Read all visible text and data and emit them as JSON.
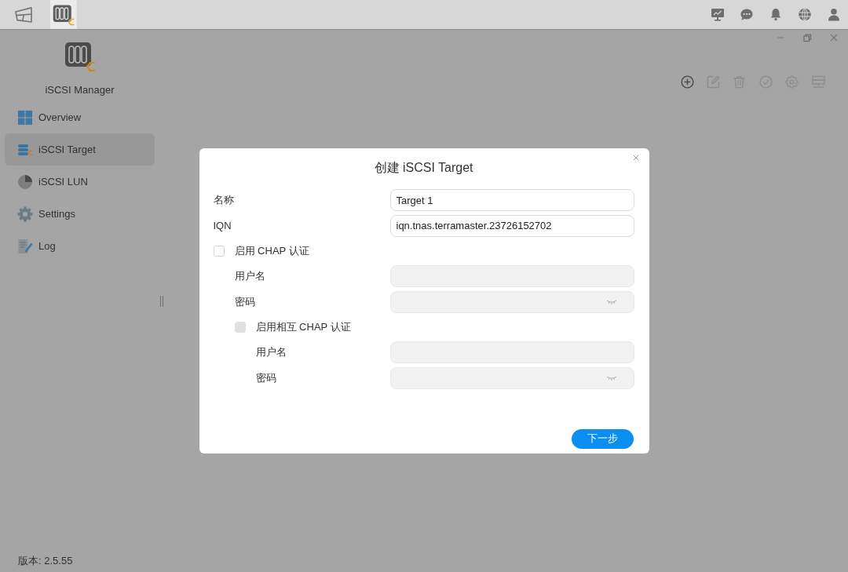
{
  "taskbar": {
    "items": [
      {
        "kind": "desktop",
        "selected": false
      },
      {
        "kind": "app",
        "selected": true
      }
    ]
  },
  "window": {
    "app_name": "iSCSI Manager",
    "nav": [
      {
        "label": "Overview",
        "selected": false
      },
      {
        "label": "iSCSI Target",
        "selected": true
      },
      {
        "label": "iSCSI LUN",
        "selected": false
      },
      {
        "label": "Settings",
        "selected": false
      },
      {
        "label": "Log",
        "selected": false
      }
    ],
    "version": "版本: 2.5.55",
    "toolbar": [
      {
        "disabled": false
      },
      {
        "disabled": true
      },
      {
        "disabled": true
      },
      {
        "disabled": true
      },
      {
        "disabled": true
      },
      {
        "disabled": true
      }
    ]
  },
  "dialog": {
    "title": "创建 iSCSI Target",
    "fields": [
      {
        "kind": "input",
        "label": "名称",
        "value": "Target 1",
        "disabled": false
      },
      {
        "kind": "input",
        "label": "IQN",
        "value": "iqn.tnas.terramaster.23726152702",
        "disabled": false
      },
      {
        "kind": "checkbox",
        "label": "启用 CHAP 认证",
        "checked": false,
        "disabled": false,
        "children": [
          {
            "kind": "input",
            "label": "用户名",
            "disabled": true
          },
          {
            "kind": "password",
            "label": "密码",
            "disabled": true
          },
          {
            "kind": "checkbox",
            "label": "启用相互 CHAP 认证",
            "checked": false,
            "disabled": true,
            "children": [
              {
                "kind": "input",
                "label": "用户名",
                "disabled": true
              },
              {
                "kind": "password",
                "label": "密码",
                "disabled": true
              }
            ]
          }
        ]
      }
    ],
    "button": "下一步"
  }
}
